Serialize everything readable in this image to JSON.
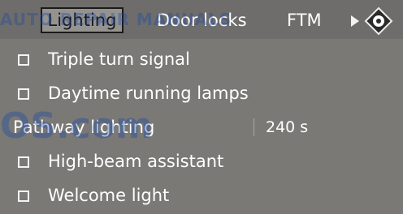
{
  "tabs": [
    {
      "label": "Lighting",
      "selected": true
    },
    {
      "label": "Door locks",
      "selected": false
    },
    {
      "label": "FTM",
      "selected": false
    }
  ],
  "tabbar": {
    "scroll_right_icon": "triangle-right-icon",
    "controller_icon": "idrive-controller-icon"
  },
  "settings": [
    {
      "label": "Triple turn signal",
      "type": "checkbox",
      "checked": false
    },
    {
      "label": "Daytime running lamps",
      "type": "checkbox",
      "checked": false
    },
    {
      "label": "Pathway lighting",
      "type": "value",
      "value": "240 s"
    },
    {
      "label": "High-beam assistant",
      "type": "checkbox",
      "checked": false
    },
    {
      "label": "Welcome light",
      "type": "checkbox",
      "checked": false
    }
  ],
  "watermark": {
    "top": "AUTO REPAIR MANUALS",
    "bottom": "OS.com"
  },
  "colors": {
    "background": "#7a7976",
    "tabbar": "#6e6d6b",
    "selected_tab": "#949390",
    "text": "#ffffff"
  }
}
